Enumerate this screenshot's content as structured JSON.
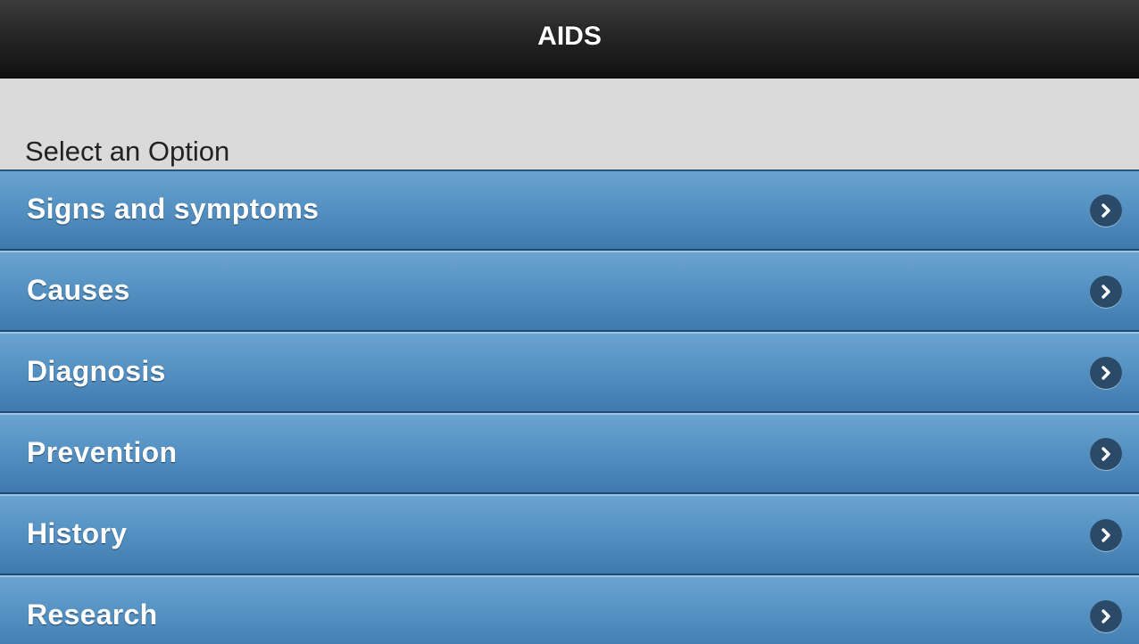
{
  "header": {
    "title": "AIDS"
  },
  "main": {
    "section_label": "Select an Option",
    "items": [
      {
        "label": "Signs and symptoms",
        "icon": "chevron-right-icon"
      },
      {
        "label": "Causes",
        "icon": "chevron-right-icon"
      },
      {
        "label": "Diagnosis",
        "icon": "chevron-right-icon"
      },
      {
        "label": "Prevention",
        "icon": "chevron-right-icon"
      },
      {
        "label": "History",
        "icon": "chevron-right-icon"
      },
      {
        "label": "Research",
        "icon": "chevron-right-icon"
      }
    ]
  },
  "colors": {
    "header_bg": "#1f1f1f",
    "content_bg": "#dadada",
    "list_item_bg": "#5592c3",
    "chevron_bg": "#2a4a68"
  }
}
